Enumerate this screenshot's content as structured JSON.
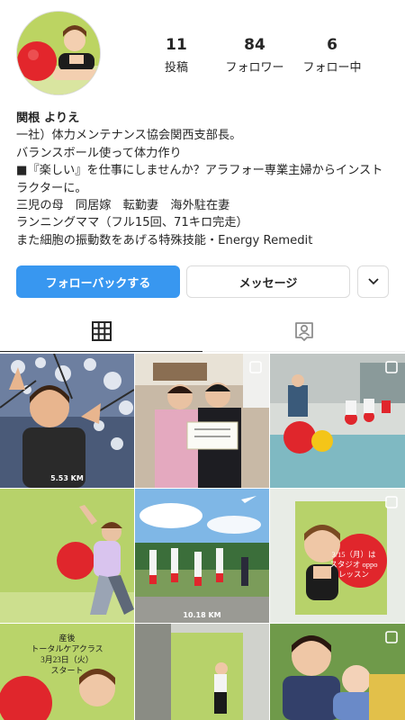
{
  "profile": {
    "posts_count": "11",
    "posts_label": "投稿",
    "followers_count": "84",
    "followers_label": "フォロワー",
    "following_count": "6",
    "following_label": "フォロー中"
  },
  "bio": {
    "name": "関根 よりえ",
    "lines": [
      "一社）体力メンテナンス協会関西支部長。",
      "バランスボール使って体力作り",
      "■『楽しい』を仕事にしませんか？アラフォー専業主婦からインストラクターに。",
      "三児の母　同居嫁　転勤妻　海外駐在妻",
      "ランニングママ（フル15回、71キロ完走）",
      "また細胞の振動数をあげる特殊技能・Energy Remedit"
    ]
  },
  "actions": {
    "follow_back": "フォローバックする",
    "message": "メッセージ",
    "more_icon": "chevron-down-icon"
  },
  "tabs": {
    "grid_icon": "grid-icon",
    "tagged_icon": "tagged-person-icon"
  },
  "posts": [
    {
      "caption": "5.53 KM"
    },
    {
      "caption": ""
    },
    {
      "caption": ""
    },
    {
      "caption": ""
    },
    {
      "caption": "10.18 KM"
    },
    {
      "caption": "3/15（月）は\nスタジオ oppo\nレッスン"
    },
    {
      "caption": "産後\nトータルケアクラス\n3月23日（火）\nスタート"
    },
    {
      "caption": ""
    },
    {
      "caption": ""
    }
  ],
  "colors": {
    "follow_button": "#3897f0",
    "ball_red": "#e0262c",
    "wall_green": "#b7d26a"
  }
}
